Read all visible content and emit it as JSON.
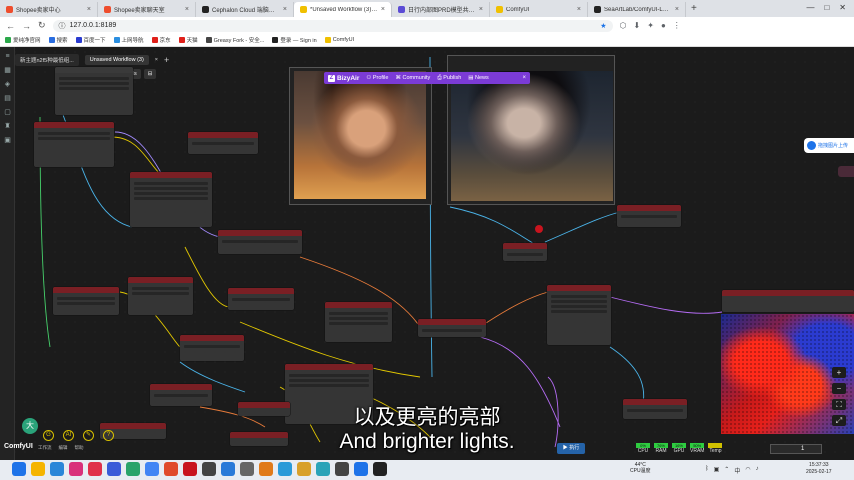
{
  "browser": {
    "tabs": [
      {
        "title": "Shopee卖家中心",
        "fav": "#ee4d2d"
      },
      {
        "title": "Shopee卖家聊天室",
        "fav": "#ee4d2d"
      },
      {
        "title": "Cephalon Cloud 端脑云 - AIGC...",
        "fav": "#222222"
      },
      {
        "title": "*Unsaved Workflow (3) - ComfyUI",
        "fav": "#f0c000",
        "active": true
      },
      {
        "title": "日行内部图PRD模型共图工作流...",
        "fav": "#5b4bd5"
      },
      {
        "title": "ComfyUI",
        "fav": "#f0c000"
      },
      {
        "title": "SeaArtLab/ComfyUI-Long-CLIP",
        "fav": "#222222"
      }
    ],
    "url": "127.0.0.1:8189",
    "bookmarks": [
      {
        "label": "爱纯净官网",
        "color": "#2ba84a"
      },
      {
        "label": "搜索",
        "color": "#2a6de0"
      },
      {
        "label": "百度一下",
        "color": "#2a3bd0"
      },
      {
        "label": "上网导航",
        "color": "#2a8ee0"
      },
      {
        "label": "京东",
        "color": "#e0201a"
      },
      {
        "label": "天猫",
        "color": "#e0201a"
      },
      {
        "label": "Greasy Fork - 安全...",
        "color": "#444444"
      },
      {
        "label": "登录 — Sign in",
        "color": "#222222"
      },
      {
        "label": "ComfyUI",
        "color": "#f0c000"
      }
    ]
  },
  "app": {
    "workflow_tabs": [
      "新主题n2f5种最低组...",
      "Unsaved Workflow (3)"
    ],
    "models_label": "Models",
    "bizyair": {
      "brand": "BizyAir",
      "items": [
        "Profile",
        "Community",
        "Publish",
        "News"
      ]
    },
    "upload_badge": "拖拽图片上传",
    "brand": "ComfyUI",
    "bottom_menu": [
      "工作流",
      "编辑",
      "帮助"
    ],
    "run_label": "执行",
    "stats": [
      {
        "label": "CPU",
        "value": "0%",
        "color": "#2ecc40"
      },
      {
        "label": "RAM",
        "value": "76%",
        "color": "#2ecc40"
      },
      {
        "label": "GPU",
        "value": "16%",
        "color": "#2ecc40"
      },
      {
        "label": "VRAM",
        "value": "50%",
        "color": "#2ecc40"
      },
      {
        "label": "Temp",
        "value": "",
        "color": "#d0c000"
      }
    ],
    "queue_count": "1"
  },
  "subtitles": {
    "zh": "以及更亮的亮部",
    "en": "And brighter lights."
  },
  "taskbar": {
    "weather_temp": "44°C",
    "weather_label": "CPU温度",
    "time": "15:37:33",
    "date": "2025-02-17"
  }
}
